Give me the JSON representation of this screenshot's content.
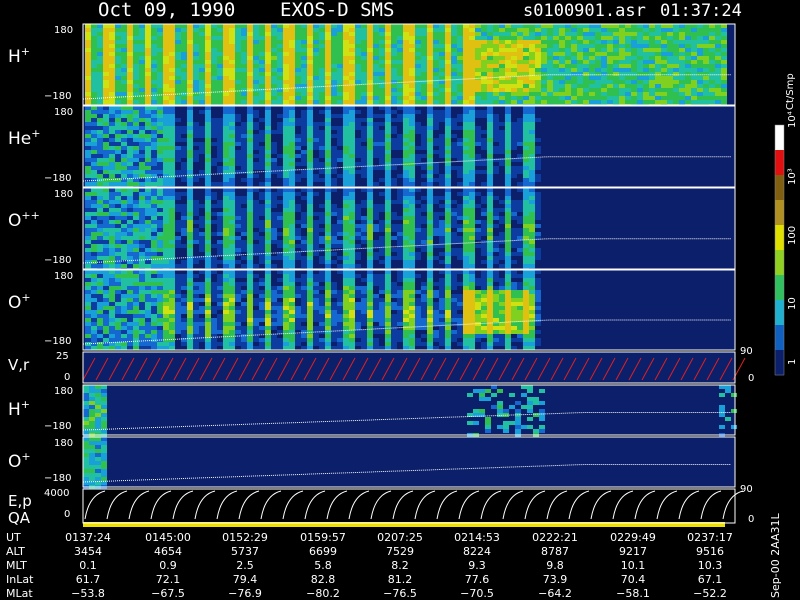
{
  "header": {
    "date": "Oct 09, 1990",
    "instrument": "EXOS-D SMS",
    "file": "s0100901.asr",
    "time": "01:37:24"
  },
  "colors": {
    "background": "#000000",
    "panel_bg": "#0b1f6b",
    "trace_white": "#ffffff",
    "vr_red": "#e02020",
    "qa_yellow": "#f0e000"
  },
  "chart_data": {
    "type": "heatmap",
    "panels": [
      {
        "label": "H",
        "sup": "+",
        "ymax": "180",
        "ymin": "−180",
        "intensity": 1.0
      },
      {
        "label": "He",
        "sup": "+",
        "ymax": "180",
        "ymin": "−180",
        "intensity": 0.45
      },
      {
        "label": "O",
        "sup": "++",
        "ymax": "180",
        "ymin": "−180",
        "intensity": 0.5
      },
      {
        "label": "O",
        "sup": "+",
        "ymax": "180",
        "ymin": "−180",
        "intensity": 0.6
      }
    ],
    "vr_panel": {
      "label": "V,r",
      "ymax": "25",
      "ymin": "0",
      "right_tick": "90",
      "right_zero": "0"
    },
    "small_panels": [
      {
        "label": "H",
        "sup": "+",
        "ymax": "180",
        "ymin": "−180"
      },
      {
        "label": "O",
        "sup": "+",
        "ymax": "180",
        "ymin": "−180"
      }
    ],
    "ep_panel": {
      "label1": "E,p",
      "label2": "QA",
      "ymax": "4000",
      "ymin": "0",
      "right_tick": "90",
      "right_zero": "0"
    },
    "colorbar": {
      "title": "Ct/Smp",
      "tick_labels": [
        "1",
        "10",
        "100",
        "10³",
        "10⁴"
      ],
      "stops": [
        "#0b1f6b",
        "#1060c0",
        "#20b0d0",
        "#30c060",
        "#90d020",
        "#e0e000",
        "#b09020",
        "#806010",
        "#e01010",
        "#ffffff"
      ]
    },
    "x_axis": {
      "rows": [
        {
          "label": "UT",
          "values": [
            "0137:24",
            "0145:00",
            "0152:29",
            "0159:57",
            "0207:25",
            "0214:53",
            "0222:21",
            "0229:49",
            "0237:17"
          ]
        },
        {
          "label": "ALT",
          "values": [
            "3454",
            "4654",
            "5737",
            "6699",
            "7529",
            "8224",
            "8787",
            "9217",
            "9516"
          ]
        },
        {
          "label": "MLT",
          "values": [
            "0.1",
            "0.9",
            "2.5",
            "5.8",
            "8.2",
            "9.3",
            "9.8",
            "10.1",
            "10.3"
          ]
        },
        {
          "label": "InLat",
          "values": [
            "61.7",
            "72.1",
            "79.4",
            "82.8",
            "81.2",
            "77.6",
            "73.9",
            "70.4",
            "67.1"
          ]
        },
        {
          "label": "MLat",
          "values": [
            "−53.8",
            "−67.5",
            "−76.9",
            "−80.2",
            "−76.5",
            "−70.5",
            "−64.2",
            "−58.1",
            "−52.2"
          ]
        }
      ]
    },
    "side_note": "Sep-00 2AA31L"
  }
}
